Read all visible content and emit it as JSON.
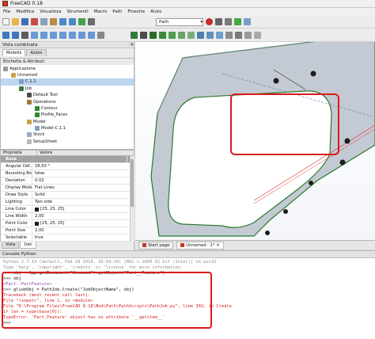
{
  "window": {
    "title": "FreeCAD 0.18"
  },
  "menu": [
    "File",
    "Modifica",
    "Visualizza",
    "Strumenti",
    "Macro",
    "Path",
    "Finestre",
    "Aiuto"
  ],
  "toolbar": {
    "workbench": "Path"
  },
  "combo_view": {
    "title": "Vista combinata",
    "tabs": [
      "Modello",
      "Azioni"
    ],
    "tree_header": "Etichette & Attributi",
    "tree": [
      {
        "label": "Applicazione",
        "indent": 0,
        "selected": false
      },
      {
        "label": "Unnamed",
        "indent": 1,
        "selected": false
      },
      {
        "label": "C.1.1",
        "indent": 2,
        "selected": true
      },
      {
        "label": "Job",
        "indent": 2,
        "selected": false
      },
      {
        "label": "Default Tool",
        "indent": 3,
        "selected": false
      },
      {
        "label": "Operations",
        "indent": 3,
        "selected": false
      },
      {
        "label": "Contour",
        "indent": 4,
        "selected": false
      },
      {
        "label": "Profile_Faces",
        "indent": 4,
        "selected": false
      },
      {
        "label": "Model",
        "indent": 3,
        "selected": false
      },
      {
        "label": "Model-C.1.1",
        "indent": 4,
        "selected": false
      },
      {
        "label": "Stock",
        "indent": 3,
        "selected": false
      },
      {
        "label": "SetupSheet",
        "indent": 3,
        "selected": false
      }
    ],
    "props_headers": {
      "name": "Proprietà",
      "value": "Valore"
    },
    "props": [
      {
        "k": "Base",
        "v": "",
        "group": true
      },
      {
        "k": "Angular Def...",
        "v": "28,50 °"
      },
      {
        "k": "Bounding Box",
        "v": "false"
      },
      {
        "k": "Deviation",
        "v": "0,02"
      },
      {
        "k": "Display Mode",
        "v": "Flat Lines"
      },
      {
        "k": "Draw Style",
        "v": "Solid"
      },
      {
        "k": "Lighting",
        "v": "Two side"
      },
      {
        "k": "Line Color",
        "v": "[25, 25, 25]",
        "swatch": true
      },
      {
        "k": "Line Width",
        "v": "2,00"
      },
      {
        "k": "Point Color",
        "v": "[25, 25, 25]",
        "swatch": true
      },
      {
        "k": "Point Size",
        "v": "2,00"
      },
      {
        "k": "Selectable",
        "v": "true"
      }
    ],
    "bottom_tabs": [
      "Vista",
      "Dati"
    ]
  },
  "document_tabs": [
    "Start page",
    "Unnamed : 1*"
  ],
  "console": {
    "title": "Console Python",
    "lines": [
      {
        "text": "Python 2.7.14 (default, Feb 28 2018, 16:59:39) [MSC v.1800 32 bit (Intel)] on win32",
        "color": "gray"
      },
      {
        "text": "Type 'help', 'copyright', 'credits' or 'license' for more information.",
        "color": "gray"
      },
      {
        "text": ">>> obj = App.getDocument(\"Unnamed\").getObject(\"Part__Feature\")",
        "color": "black"
      },
      {
        "text": ">>> obj",
        "color": "black"
      },
      {
        "text": "<Part::PartFeature>",
        "color": "purple"
      },
      {
        "text": ">>> gliobObj = PathJob.Create(\"JobObjectName\", obj)",
        "color": "black"
      },
      {
        "text": "Traceback (most recent call last):",
        "color": "red"
      },
      {
        "text": "  File \"<input>\", line 1, in <module>",
        "color": "red"
      },
      {
        "text": "  File \"D:\\Program Files\\FreeCAD 0.18\\Mod\\Path\\PathScripts\\PathJob.py\", line 392, in Create",
        "color": "red"
      },
      {
        "text": "    if len = type(base[0]):",
        "color": "red"
      },
      {
        "text": "TypeError: 'Part.Feature' object has no attribute '__getitem__'",
        "color": "red"
      },
      {
        "text": ">>>",
        "color": "black"
      }
    ]
  },
  "colors": {
    "highlight": "#d81b1b",
    "selection": "#bdd7ee",
    "model_fill": "#c4cad3"
  }
}
